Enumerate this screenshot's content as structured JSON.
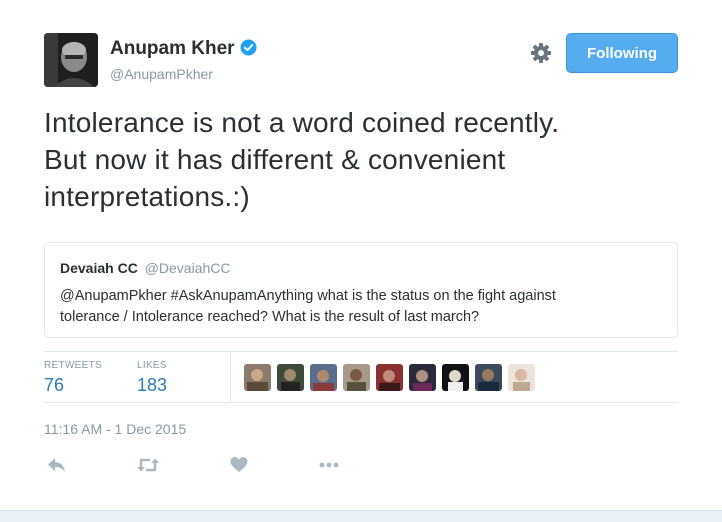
{
  "tweet": {
    "author_name": "Anupam Kher",
    "author_handle": "@AnupamPkher",
    "verified_icon": "verified-badge-icon",
    "follow_button_label": "Following",
    "text_lines": [
      "Intolerance is not a word coined recently.",
      "But now it has different & convenient",
      "interpretations.:)"
    ],
    "timestamp": "11:16 AM - 1 Dec 2015"
  },
  "quoted_tweet": {
    "author_name": "Devaiah CC",
    "author_handle": "@DevaiahCC",
    "text_lines": [
      "@AnupamPkher #AskAnupamAnything what is the status on the fight against",
      "tolerance / Intolerance reached? What is the result of last march?"
    ]
  },
  "stats": {
    "retweets_label": "RETWEETS",
    "retweets_count": "76",
    "likes_label": "LIKES",
    "likes_count": "183"
  },
  "colors": {
    "accent": "#55acee",
    "link_blue": "#2b7bb9",
    "muted": "#8899a6",
    "text": "#292f33"
  },
  "icons": [
    "settings-gear-icon",
    "reply-icon",
    "retweet-icon",
    "like-heart-icon",
    "more-options-icon"
  ]
}
